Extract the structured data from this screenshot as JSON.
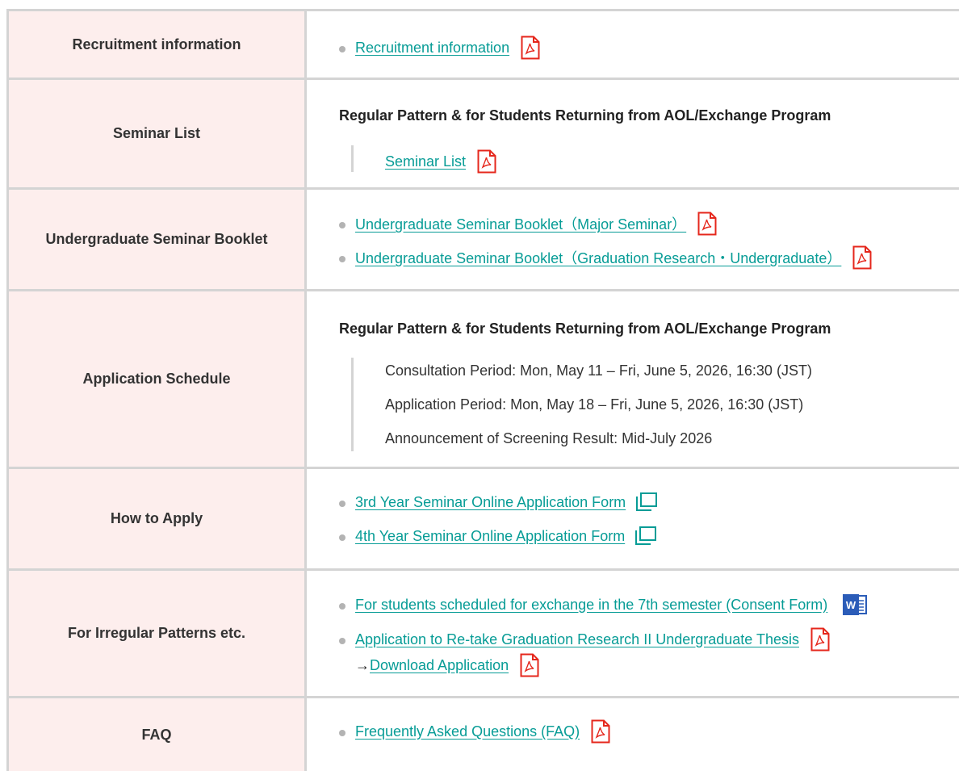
{
  "rows": {
    "recruitment": {
      "label": "Recruitment information",
      "link": "Recruitment information"
    },
    "seminar_list": {
      "label": "Seminar List",
      "subheading": "Regular Pattern & for Students Returning from AOL/Exchange Program",
      "link": "Seminar List"
    },
    "booklet": {
      "label": "Undergraduate Seminar Booklet",
      "links": [
        "Undergraduate Seminar Booklet（Major Seminar）",
        "Undergraduate Seminar Booklet（Graduation Research・Undergraduate）"
      ]
    },
    "schedule": {
      "label": "Application Schedule",
      "subheading": "Regular Pattern & for Students Returning from AOL/Exchange Program",
      "lines": [
        "Consultation Period: Mon, May 11 – Fri, June 5, 2026, 16:30 (JST)",
        "Application Period: Mon, May 18 – Fri, June 5, 2026, 16:30 (JST)",
        "Announcement of Screening Result: Mid-July 2026"
      ]
    },
    "how_to_apply": {
      "label": "How to Apply",
      "links": [
        "3rd Year Seminar Online Application Form",
        "4th Year Seminar Online Application Form"
      ]
    },
    "irregular": {
      "label": "For Irregular Patterns etc.",
      "links": [
        "For students scheduled for exchange in the 7th semester (Consent Form)",
        "Application to Re-take Graduation Research II Undergraduate Thesis"
      ],
      "arrow": "→",
      "download": "Download Application"
    },
    "faq": {
      "label": "FAQ",
      "link": "Frequently Asked Questions (FAQ)"
    }
  },
  "icons": {
    "pdf": "pdf-icon",
    "new_window": "new-window-icon",
    "word": "word-icon"
  },
  "colors": {
    "link": "#079c96",
    "header_bg": "#fdeeed",
    "border": "#d4d4d4",
    "pdf": "#e5271c",
    "word": "#2b5cb8"
  }
}
